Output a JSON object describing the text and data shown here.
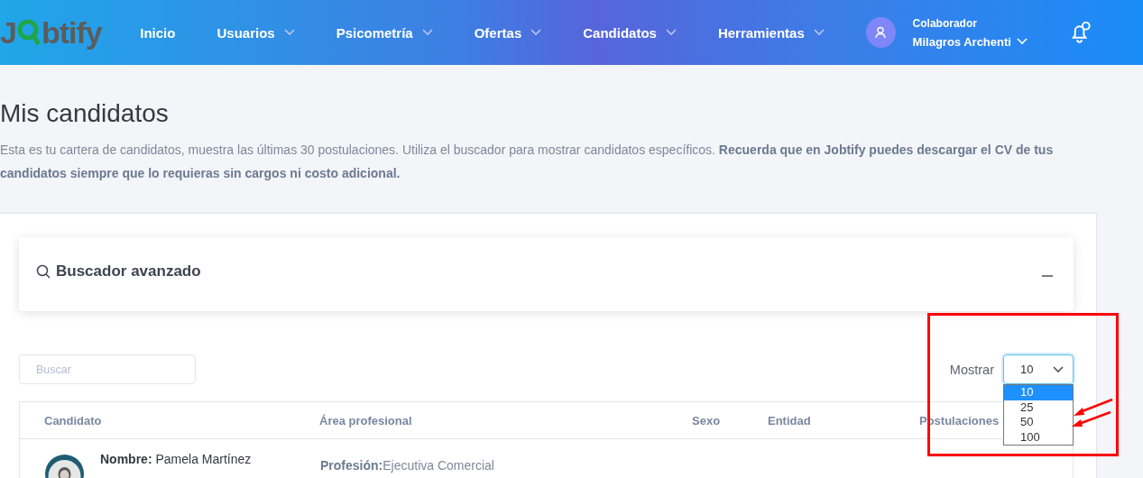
{
  "header": {
    "logo": {
      "first": "J",
      "rest": "btify"
    },
    "nav": [
      {
        "label": "Inicio",
        "dropdown": false
      },
      {
        "label": "Usuarios",
        "dropdown": true
      },
      {
        "label": "Psicometría",
        "dropdown": true
      },
      {
        "label": "Ofertas",
        "dropdown": true
      },
      {
        "label": "Candidatos",
        "dropdown": true
      },
      {
        "label": "Herramientas",
        "dropdown": true
      }
    ],
    "user": {
      "role": "Colaborador",
      "name": "Milagros Archenti"
    }
  },
  "page": {
    "title": "Mis candidatos",
    "intro": "Esta es tu cartera de candidatos, muestra las últimas 30 postulaciones. Utiliza el buscador para mostrar candidatos específicos. **Recuerda que en Jobtify puedes descargar el CV de tus candidatos siempre que lo requieras sin cargos ni costo adicional.**"
  },
  "advanced_search": {
    "title": "Buscador avanzado",
    "expanded": false
  },
  "search": {
    "placeholder": "Buscar"
  },
  "page_size": {
    "label": "Mostrar",
    "value": "10",
    "open": true,
    "options": [
      {
        "label": "10",
        "selected": true
      },
      {
        "label": "25",
        "selected": false
      },
      {
        "label": "50",
        "selected": false
      },
      {
        "label": "100",
        "selected": false
      }
    ]
  },
  "table": {
    "columns": [
      "Candidato",
      "Área profesional",
      "Sexo",
      "Entidad",
      "Postulaciones"
    ],
    "rows": [
      {
        "name_label": "Nombre:",
        "name": "Pamela Martínez",
        "profession_label": "Profesión:",
        "profession": "Ejecutiva Comercial"
      }
    ]
  }
}
